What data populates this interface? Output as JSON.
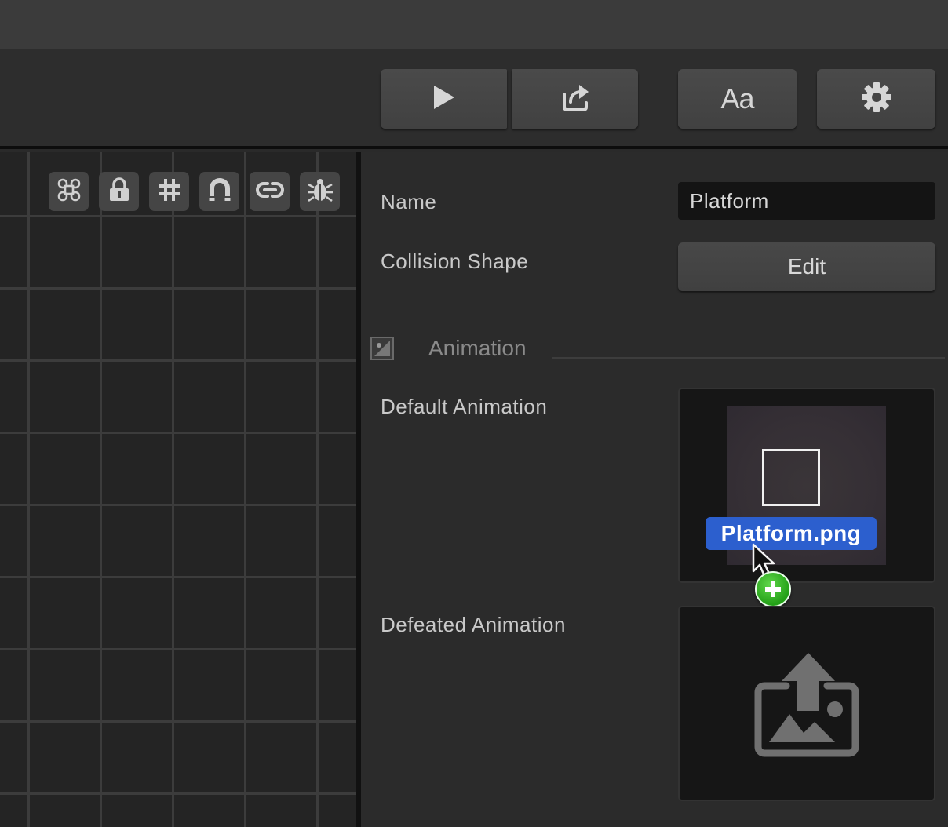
{
  "toolbar": {
    "play_icon": "play-icon",
    "share_icon": "share-icon",
    "font_button_label": "Aa",
    "settings_icon": "gear-icon"
  },
  "canvas_tools": [
    {
      "name": "command-icon"
    },
    {
      "name": "lock-icon"
    },
    {
      "name": "grid-icon"
    },
    {
      "name": "magnet-icon"
    },
    {
      "name": "link-icon"
    },
    {
      "name": "bug-icon"
    }
  ],
  "inspector": {
    "name_label": "Name",
    "name_value": "Platform",
    "collision_label": "Collision Shape",
    "collision_button": "Edit",
    "section_title": "Animation",
    "default_animation_label": "Default Animation",
    "defeated_animation_label": "Defeated Animation"
  },
  "drag": {
    "file_name": "Platform.png",
    "badge": "plus-icon"
  },
  "colors": {
    "accent_selection": "#2c5fce",
    "badge_green": "#23a017"
  }
}
